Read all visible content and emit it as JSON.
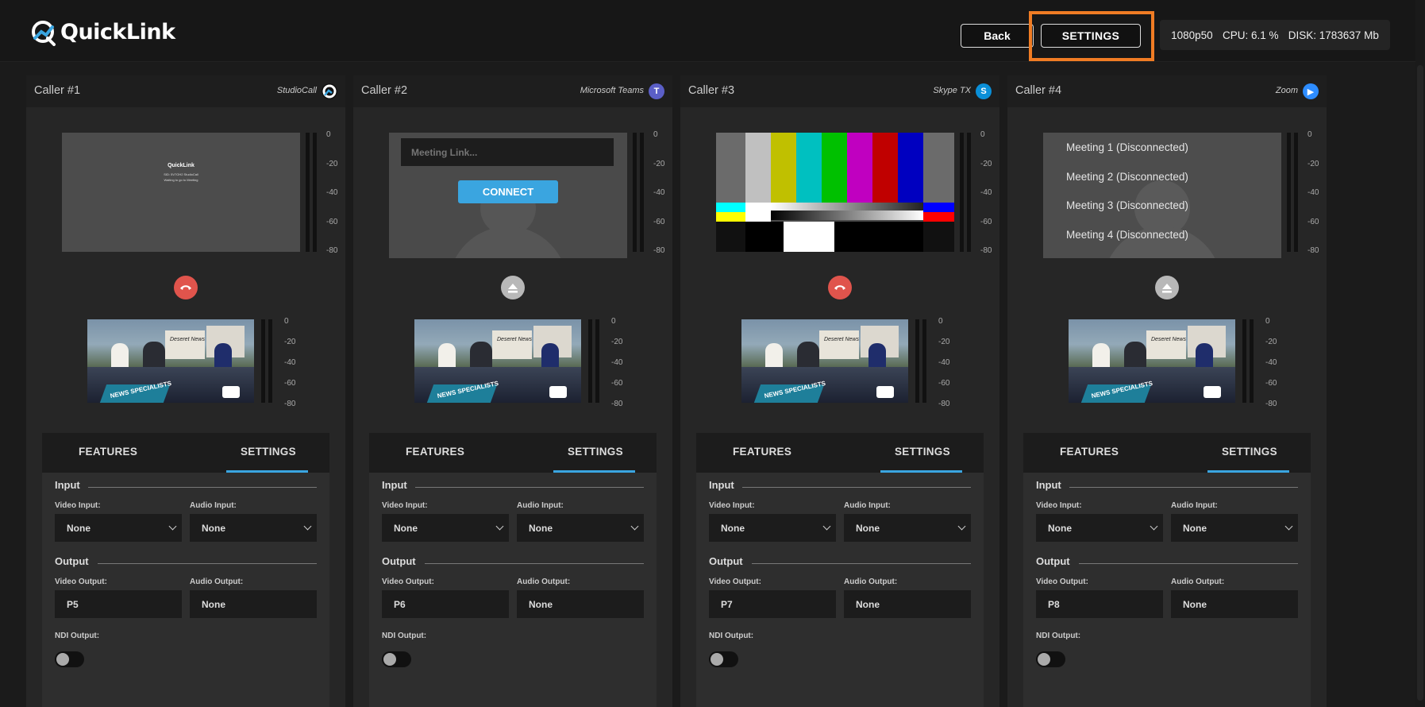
{
  "app": {
    "name": "QuickLink"
  },
  "header": {
    "back_label": "Back",
    "settings_label": "SETTINGS",
    "resolution": "1080p50",
    "cpu": "CPU: 6.1 %",
    "disk": "DISK: 1783637 Mb"
  },
  "colors": {
    "accent": "#3aa5e0",
    "highlight": "#f07c24",
    "end_call": "#e0544c"
  },
  "vu_scale": [
    "0",
    "-20",
    "-40",
    "-60",
    "-80"
  ],
  "callers": [
    {
      "title": "Caller #1",
      "service": "StudioCall",
      "service_icon": "studiocall-icon",
      "call_state": "end-call",
      "preview": {
        "type": "studiocall",
        "logo": "QuickLink",
        "line1": "SID: 5V7OH2 StudioCall",
        "line2": "Waiting to go to Meeting"
      },
      "tabs": [
        "FEATURES",
        "SETTINGS"
      ],
      "input_section": "Input",
      "video_input_label": "Video Input:",
      "video_input": "None",
      "audio_input_label": "Audio Input:",
      "audio_input": "None",
      "output_section": "Output",
      "video_output_label": "Video Output:",
      "video_output": "P5",
      "audio_output_label": "Audio Output:",
      "audio_output": "None",
      "ndi_label": "NDI Output:",
      "ndi_enabled": false
    },
    {
      "title": "Caller #2",
      "service": "Microsoft Teams",
      "service_icon": "teams-icon",
      "call_state": "eject",
      "preview": {
        "type": "meeting-link",
        "placeholder": "Meeting Link...",
        "connect_label": "CONNECT"
      },
      "tabs": [
        "FEATURES",
        "SETTINGS"
      ],
      "input_section": "Input",
      "video_input_label": "Video Input:",
      "video_input": "None",
      "audio_input_label": "Audio Input:",
      "audio_input": "None",
      "output_section": "Output",
      "video_output_label": "Video Output:",
      "video_output": "P6",
      "audio_output_label": "Audio Output:",
      "audio_output": "None",
      "ndi_label": "NDI Output:",
      "ndi_enabled": false
    },
    {
      "title": "Caller #3",
      "service": "Skype TX",
      "service_icon": "skype-icon",
      "call_state": "end-call",
      "preview": {
        "type": "color-bars"
      },
      "tabs": [
        "FEATURES",
        "SETTINGS"
      ],
      "input_section": "Input",
      "video_input_label": "Video Input:",
      "video_input": "None",
      "audio_input_label": "Audio Input:",
      "audio_input": "None",
      "output_section": "Output",
      "video_output_label": "Video Output:",
      "video_output": "P7",
      "audio_output_label": "Audio Output:",
      "audio_output": "None",
      "ndi_label": "NDI Output:",
      "ndi_enabled": false
    },
    {
      "title": "Caller #4",
      "service": "Zoom",
      "service_icon": "zoom-icon",
      "call_state": "eject",
      "preview": {
        "type": "meetings",
        "meetings": [
          "Meeting 1 (Disconnected)",
          "Meeting 2 (Disconnected)",
          "Meeting 3 (Disconnected)",
          "Meeting 4 (Disconnected)"
        ]
      },
      "tabs": [
        "FEATURES",
        "SETTINGS"
      ],
      "input_section": "Input",
      "video_input_label": "Video Input:",
      "video_input": "None",
      "audio_input_label": "Audio Input:",
      "audio_input": "None",
      "output_section": "Output",
      "video_output_label": "Video Output:",
      "video_output": "P8",
      "audio_output_label": "Audio Output:",
      "audio_output": "None",
      "ndi_label": "NDI Output:",
      "ndi_enabled": false
    }
  ],
  "program_feed": {
    "band_text": "NEWS SPECIALISTS",
    "screen_text": "Deseret News"
  }
}
